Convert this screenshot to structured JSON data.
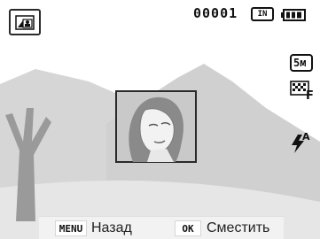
{
  "status_bar": {
    "shot_counter": "00001",
    "storage_label": "IN",
    "battery_level": 1.0
  },
  "icons": {
    "mode": "scene-mode-icon",
    "storage": "internal-memory-icon",
    "battery": "battery-full-icon",
    "size": "photo-size-5m-icon",
    "quality": "image-quality-fine-icon",
    "flash": "flash-auto-icon"
  },
  "size_label": "5м",
  "quality_label": "F",
  "flash_label": "A",
  "bottom_bar": {
    "menu_key": "MENU",
    "menu_action": "Назад",
    "ok_key": "OK",
    "ok_action": "Сместить"
  },
  "colors": {
    "sky": "#ffffff",
    "mountains": "#cfcfcf",
    "ground": "#e4e4e4",
    "tree": "#9a9a9a",
    "photo_frame_border": "#2a2a2a"
  }
}
